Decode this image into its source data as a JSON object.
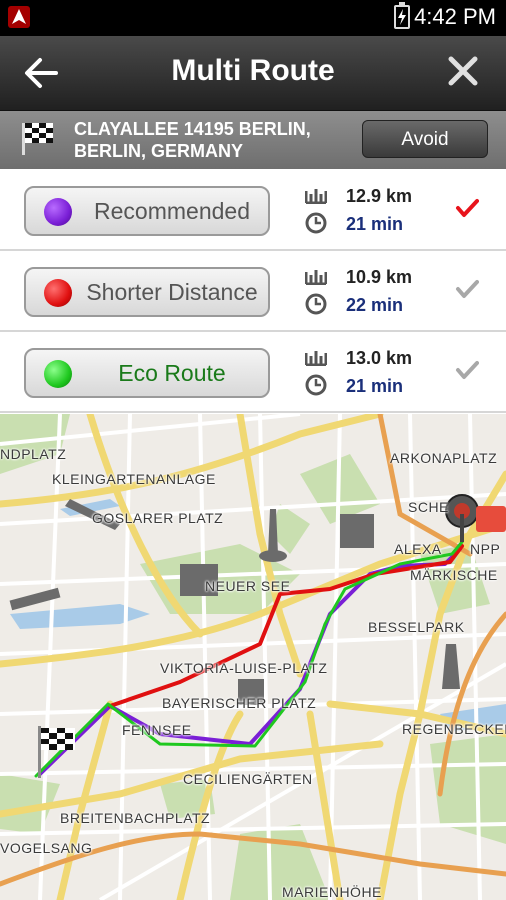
{
  "status_bar": {
    "time": "4:42 PM"
  },
  "header": {
    "title": "Multi Route",
    "back_icon": "arrow-left-icon",
    "close_icon": "close-icon"
  },
  "destination": {
    "address_line1": "CLAYALLEE 14195 BERLIN,",
    "address_line2": "BERLIN, GERMANY",
    "avoid_label": "Avoid"
  },
  "routes": [
    {
      "label": "Recommended",
      "dot_color": "#7a1fd6",
      "distance": "12.9 km",
      "time": "21 min",
      "selected": true
    },
    {
      "label": "Shorter Distance",
      "dot_color": "#e01010",
      "distance": "10.9 km",
      "time": "22 min",
      "selected": false
    },
    {
      "label": "Eco Route",
      "dot_color": "#1fc81f",
      "label_color": "#1a7a1a",
      "distance": "13.0 km",
      "time": "21 min",
      "selected": false
    }
  ],
  "map": {
    "labels": [
      "NDPLATZ",
      "ARKONAPLATZ",
      "KLEINGARTENANLAGE",
      "GOSLARER PLATZ",
      "SCHE",
      "ALEXA",
      "NPP",
      "MÄRKISCHE",
      "NEUER SEE",
      "BESSELPARK",
      "VIKTORIA-LUISE-PLATZ",
      "BAYERISCHER PLATZ",
      "FENNSEE",
      "REGENBECKEN",
      "CECILIENGÄRTEN",
      "BREITENBACHPLATZ",
      "VOGELSANG",
      "MARIENHÖHE"
    ]
  }
}
